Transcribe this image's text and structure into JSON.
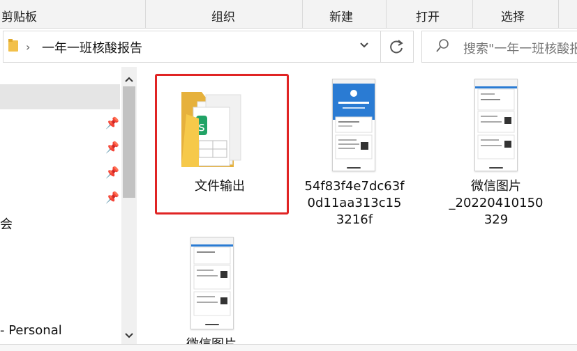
{
  "ribbon": {
    "groups": [
      "剪贴板",
      "组织",
      "新建",
      "打开",
      "选择"
    ]
  },
  "address": {
    "crumb": "一年一班核酸报告",
    "search_placeholder": "搜索\"一年一班核酸报"
  },
  "nav": {
    "partial_label": "会",
    "personal_label": "- Personal"
  },
  "files": [
    {
      "name": "文件输出",
      "type": "folder"
    },
    {
      "name_lines": [
        "54f83f4e7dc63f",
        "0d11aa313c15",
        "3216f"
      ],
      "type": "image"
    },
    {
      "name_lines": [
        "微信图片",
        "_20220410150",
        "329"
      ],
      "type": "image"
    },
    {
      "name": "微信图片",
      "type": "image"
    }
  ],
  "colors": {
    "selection_border": "#e02424",
    "folder_yellow": "#f6c94a",
    "screenshot_blue": "#2a7bd3"
  }
}
